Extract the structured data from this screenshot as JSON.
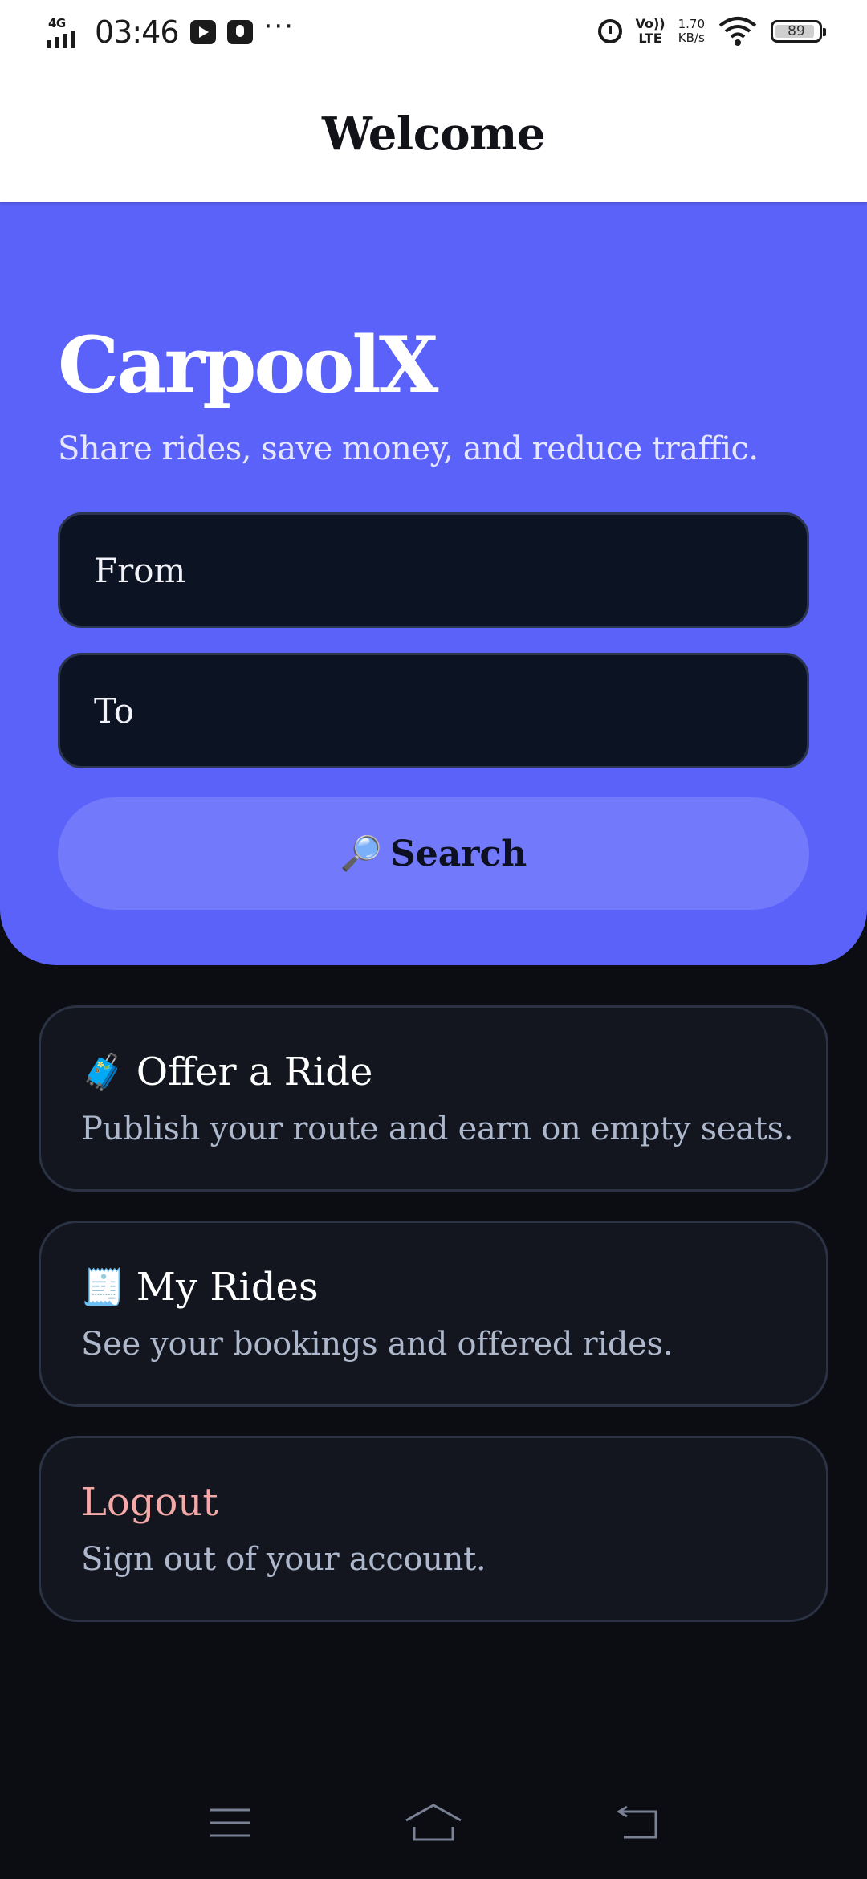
{
  "status_bar": {
    "network": "4G",
    "time": "03:46",
    "more": "···",
    "volte_top": "Vo))",
    "volte_bottom": "LTE",
    "speed_value": "1.70",
    "speed_unit": "KB/s",
    "battery": "89"
  },
  "header": {
    "title": "Welcome"
  },
  "hero": {
    "brand": "CarpoolX",
    "tagline": "Share rides, save money, and reduce traffic.",
    "from_placeholder": "From",
    "to_placeholder": "To",
    "search_icon": "🔎",
    "search_label": "Search",
    "accent_color": "#5b62f9"
  },
  "cards": {
    "offer": {
      "icon": "🧳",
      "title": "Offer a Ride",
      "description": "Publish your route and earn on empty seats."
    },
    "rides": {
      "icon": "🧾",
      "title": "My Rides",
      "description": "See your bookings and offered rides."
    },
    "logout": {
      "title": "Logout",
      "description": "Sign out of your account."
    }
  },
  "nav_icons": [
    "menu-icon",
    "home-icon",
    "back-icon"
  ]
}
